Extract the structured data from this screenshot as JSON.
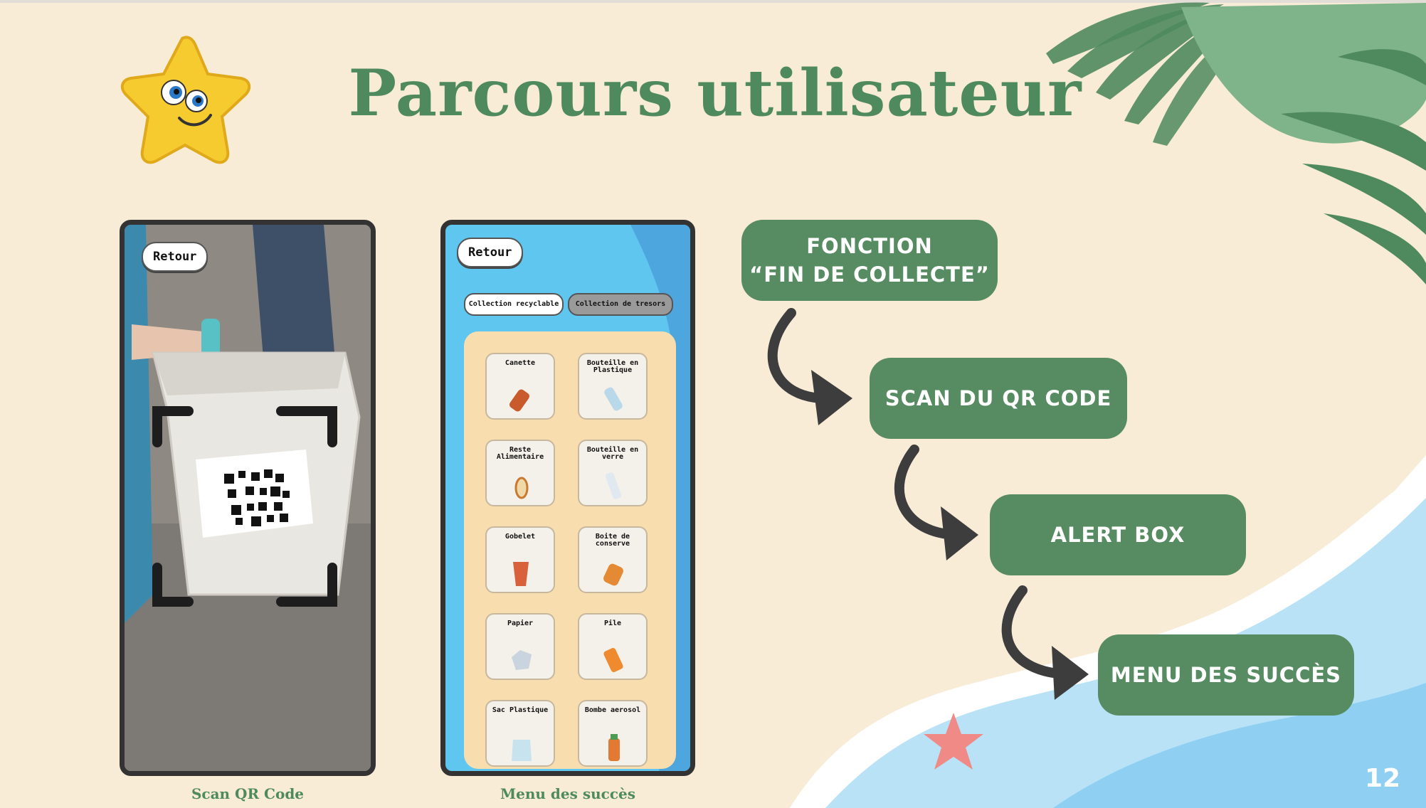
{
  "title": "Parcours utilisateur",
  "phones": {
    "scan": {
      "back_label": "Retour",
      "caption": "Scan QR Code"
    },
    "menu": {
      "back_label": "Retour",
      "caption": "Menu des succès",
      "tabs": [
        "Collection recyclable",
        "Collection de tresors"
      ],
      "items": [
        "Canette",
        "Bouteille en Plastique",
        "Reste Alimentaire",
        "Bouteille en verre",
        "Gobelet",
        "Boite de conserve",
        "Papier",
        "Pile",
        "Sac Plastique",
        "Bombe aerosol"
      ]
    }
  },
  "flow": {
    "steps": [
      {
        "line1": "FONCTION",
        "line2": "“FIN DE COLLECTE”"
      },
      {
        "line1": "SCAN DU QR CODE"
      },
      {
        "line1": "ALERT BOX"
      },
      {
        "line1": "MENU DES SUCCÈS"
      }
    ]
  },
  "page_number": "12",
  "colors": {
    "background": "#f8ecd6",
    "accent_green": "#578c63",
    "title_green": "#4f8a5e",
    "sea_blue": "#8fd0f2",
    "phone_blue": "#5fc6ef"
  },
  "icons": [
    "star-mascot-icon",
    "palm-leaves-icon",
    "starfish-icon",
    "curved-arrow-icon",
    "qr-code-icon"
  ]
}
